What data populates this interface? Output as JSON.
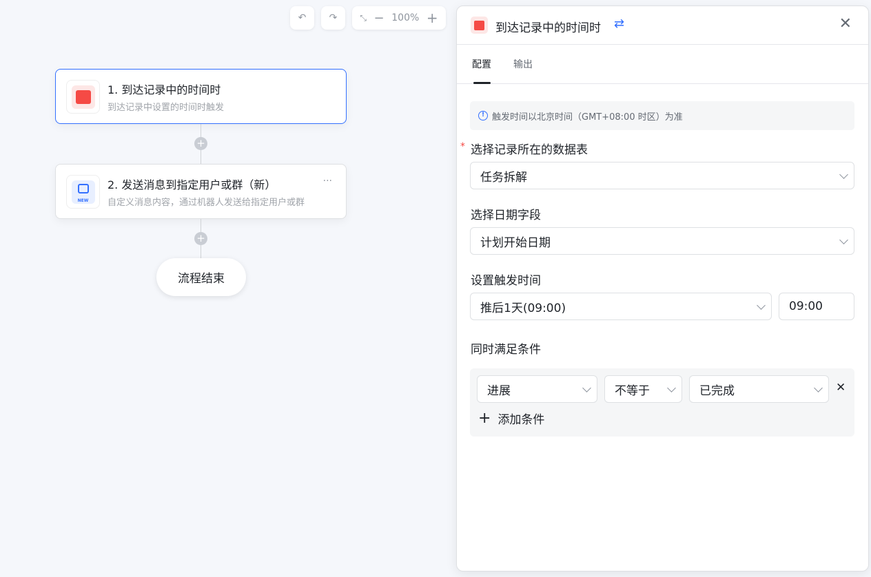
{
  "toolbar": {
    "zoom": "100%"
  },
  "nodes": [
    {
      "title": "1. 到达记录中的时间时",
      "desc": "到达记录中设置的时间时触发"
    },
    {
      "title": "2. 发送消息到指定用户或群（新）",
      "desc": "自定义消息内容，通过机器人发送给指定用户或群",
      "badge": "NEW"
    }
  ],
  "end_label": "流程结束",
  "panel": {
    "title": "到达记录中的时间时",
    "tabs": [
      "配置",
      "输出"
    ],
    "notice": "触发时间以北京时间（GMT+08:00 时区）为准",
    "table_label": "选择记录所在的数据表",
    "table_value": "任务拆解",
    "date_label": "选择日期字段",
    "date_value": "计划开始日期",
    "time_label": "设置触发时间",
    "offset_value": "推后1天(09:00)",
    "time_value": "09:00",
    "cond_label": "同时满足条件",
    "condition": {
      "field": "进展",
      "op": "不等于",
      "value": "已完成"
    },
    "add_condition": "添加条件"
  },
  "colors": {
    "accent": "#3370ff",
    "trigger": "#f54a45"
  }
}
